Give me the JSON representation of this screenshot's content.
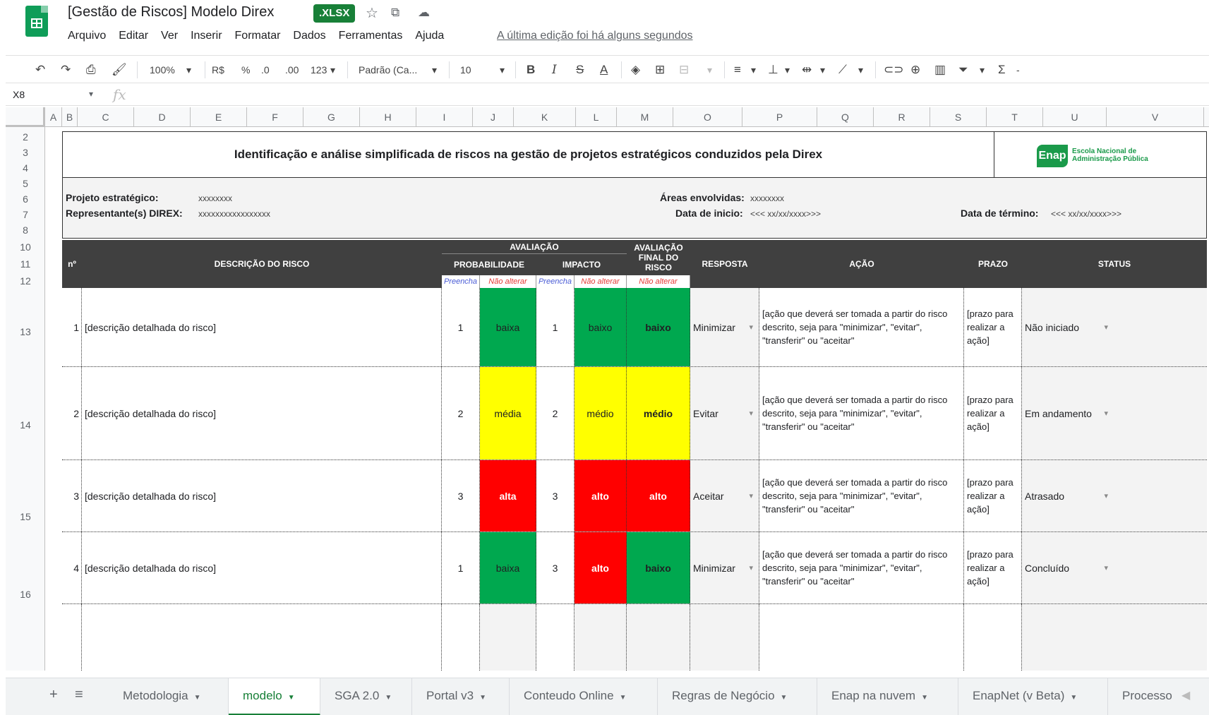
{
  "window": {
    "doc_title": "[Gestão de Riscos] Modelo Direx",
    "badge": ".XLSX",
    "last_edit": "A última edição foi há alguns segundos"
  },
  "menu": [
    "Arquivo",
    "Editar",
    "Ver",
    "Inserir",
    "Formatar",
    "Dados",
    "Ferramentas",
    "Ajuda"
  ],
  "toolbar": {
    "zoom": "100%",
    "currency": "R$",
    "percent": "%",
    "dec_less": ".0",
    "dec_more": ".00",
    "format": "123",
    "font": "Padrão (Ca...",
    "font_size": "10"
  },
  "formula_bar": {
    "cell_ref": "X8",
    "fx": "fx"
  },
  "columns": [
    "A",
    "B",
    "C",
    "D",
    "E",
    "F",
    "G",
    "H",
    "I",
    "J",
    "K",
    "L",
    "M",
    "O",
    "P",
    "Q",
    "R",
    "S",
    "T",
    "U",
    "V"
  ],
  "rows": [
    "2",
    "3",
    "4",
    "5",
    "6",
    "7",
    "8",
    "10",
    "11",
    "12",
    "13",
    "14",
    "15",
    "16"
  ],
  "sheet": {
    "title": "Identificação e análise simplificada de riscos na gestão de projetos estratégicos conduzidos pela Direx",
    "logo_text": "Enap",
    "logo_name": "Escola Nacional de Administração Pública",
    "info": {
      "projeto_label": "Projeto estratégico:",
      "projeto_value": "xxxxxxxx",
      "rep_label": "Representante(s) DIREX:",
      "rep_value": "xxxxxxxxxxxxxxxxx",
      "areas_label": "Áreas envolvidas:",
      "areas_value": "xxxxxxxx",
      "inicio_label": "Data de inicio:",
      "inicio_value": "<<< xx/xx/xxxx>>>",
      "termino_label": "Data de término:",
      "termino_value": "<<< xx/xx/xxxx>>>"
    },
    "headers": {
      "n": "nº",
      "descricao": "DESCRIÇÃO DO RISCO",
      "avaliacao": "AVALIAÇÃO",
      "probabilidade": "PROBABILIDADE",
      "impacto": "IMPACTO",
      "avaliacao_final": "AVALIAÇÃO FINAL DO RISCO",
      "resposta": "RESPOSTA",
      "acao": "AÇÃO",
      "prazo": "PRAZO",
      "status": "STATUS",
      "preencha": "Preencha",
      "nao_alterar": "Não alterar"
    },
    "risks": [
      {
        "n": "1",
        "desc": "[descrição detalhada do risco]",
        "p": "1",
        "p_label": "baixa",
        "i": "1",
        "i_label": "baixo",
        "final": "baixo",
        "resposta": "Minimizar",
        "acao": "[ação que deverá ser tomada a partir do risco descrito, seja para \"minimizar\", \"evitar\", \"transferir\" ou \"aceitar\"",
        "prazo": "[prazo para realizar a ação]",
        "status": "Não iniciado"
      },
      {
        "n": "2",
        "desc": "[descrição detalhada do risco]",
        "p": "2",
        "p_label": "média",
        "i": "2",
        "i_label": "médio",
        "final": "médio",
        "resposta": "Evitar",
        "acao": "[ação que deverá ser tomada a partir do risco descrito, seja para \"minimizar\", \"evitar\", \"transferir\" ou \"aceitar\"",
        "prazo": "[prazo para realizar a ação]",
        "status": "Em andamento"
      },
      {
        "n": "3",
        "desc": "[descrição detalhada do risco]",
        "p": "3",
        "p_label": "alta",
        "i": "3",
        "i_label": "alto",
        "final": "alto",
        "resposta": "Aceitar",
        "acao": "[ação que deverá ser tomada a partir do risco descrito, seja para \"minimizar\", \"evitar\", \"transferir\" ou \"aceitar\"",
        "prazo": "[prazo para realizar a ação]",
        "status": "Atrasado"
      },
      {
        "n": "4",
        "desc": "[descrição detalhada do risco]",
        "p": "1",
        "p_label": "baixa",
        "i": "3",
        "i_label": "alto",
        "final": "baixo",
        "resposta": "Minimizar",
        "acao": "[ação que deverá ser tomada a partir do risco descrito, seja para \"minimizar\", \"evitar\", \"transferir\" ou \"aceitar\"",
        "prazo": "[prazo para realizar a ação]",
        "status": "Concluído"
      }
    ]
  },
  "tabs": [
    "Metodologia",
    "modelo",
    "SGA 2.0",
    "Portal v3",
    "Conteudo Online",
    "Regras de Negócio",
    "Enap na nuvem",
    "EnapNet (v Beta)",
    "Processo"
  ],
  "colors": {
    "green": "#00a84f",
    "yellow": "#ffff00",
    "red": "#ff0000",
    "header": "#404040",
    "accent": "#188038"
  }
}
